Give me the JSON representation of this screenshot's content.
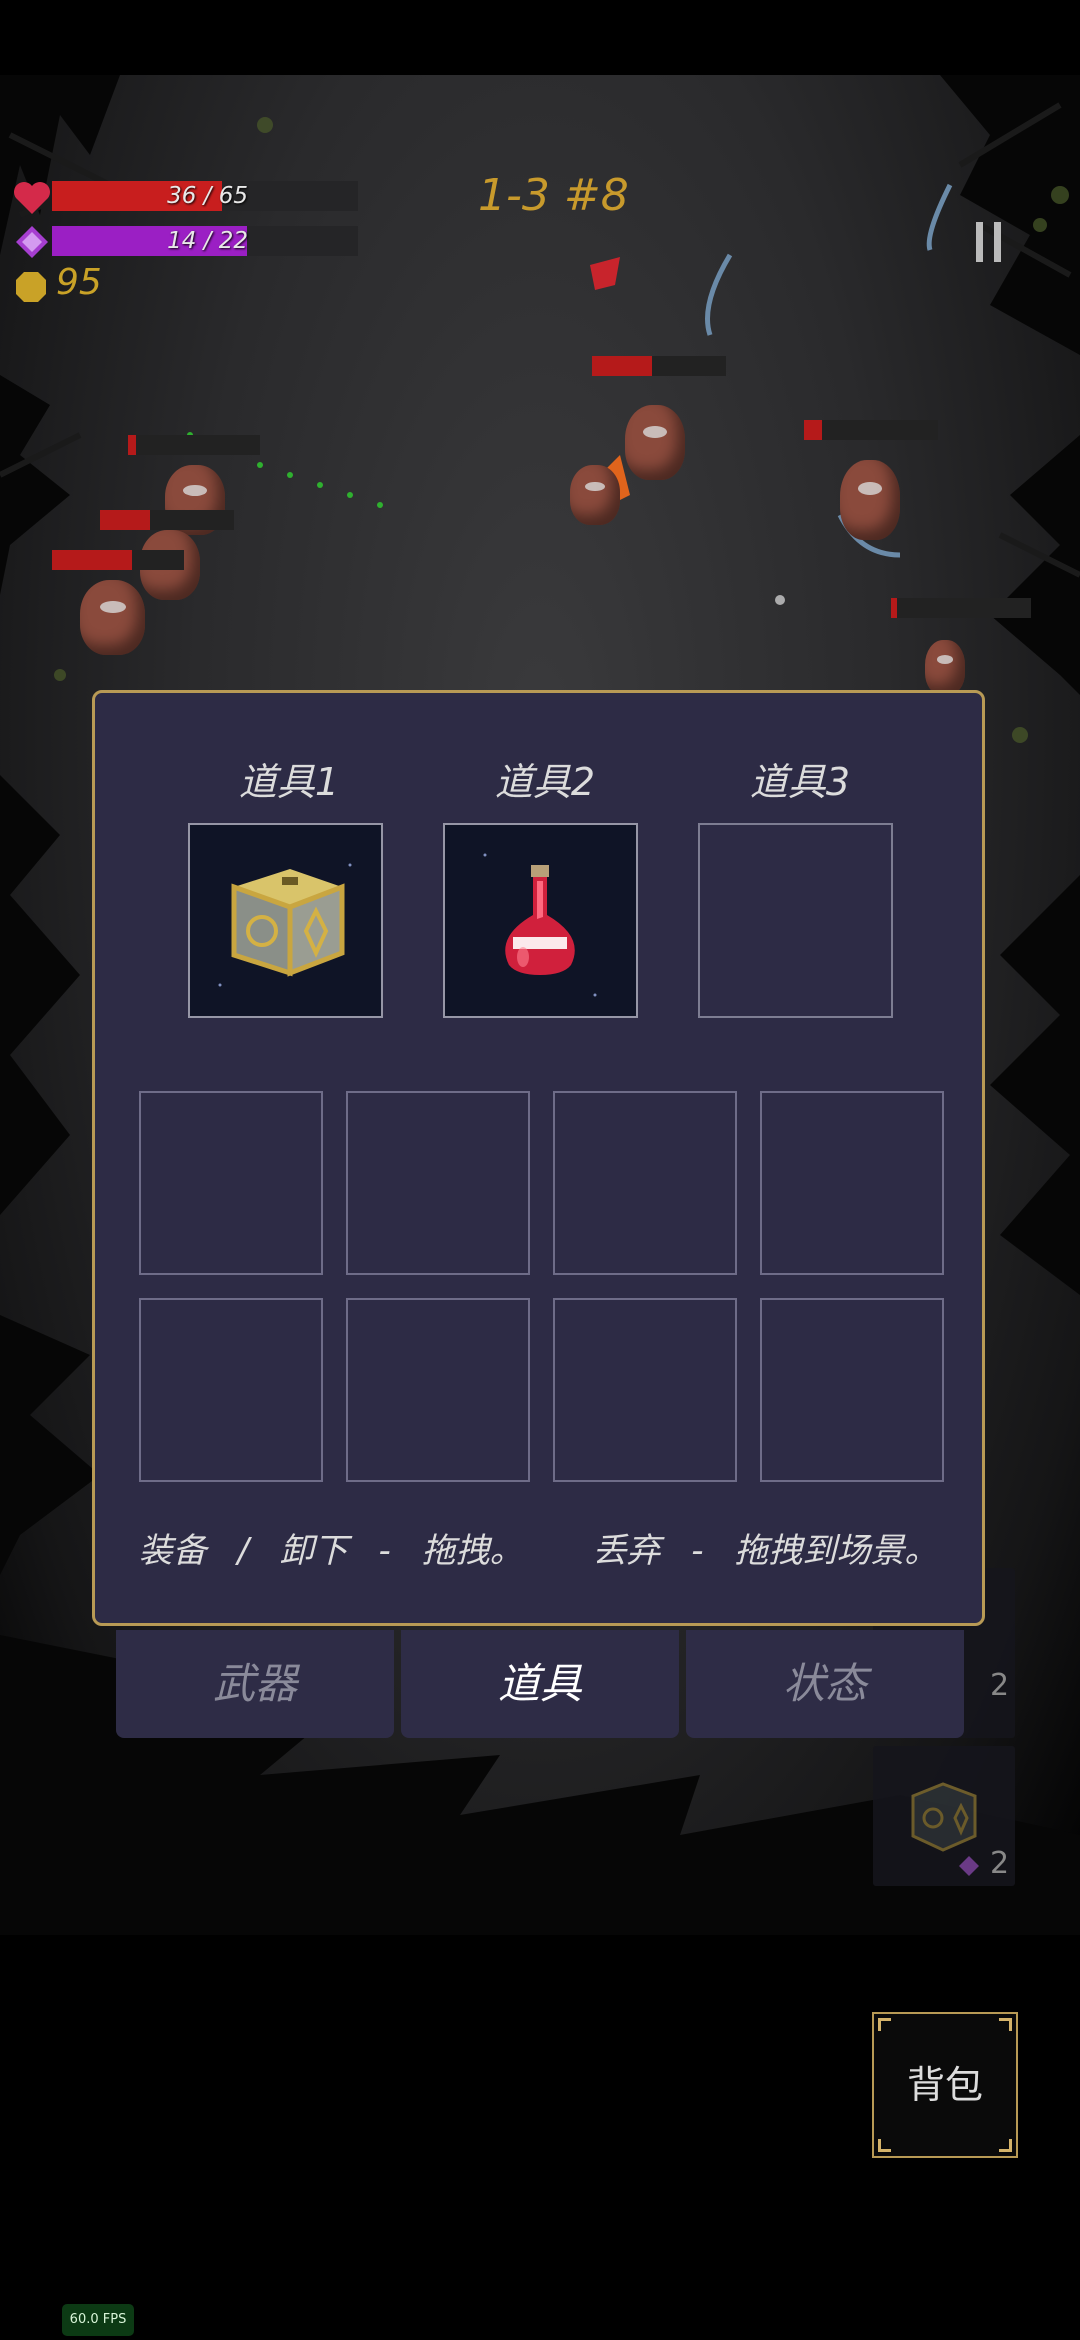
{
  "hud": {
    "hp_text": "36 / 65",
    "hp_fraction": 0.554,
    "mana_text": "14 / 22",
    "mana_fraction": 0.636,
    "gold": "95",
    "level_label": "1-3 #8",
    "colors": {
      "hp": "#c81e1e",
      "mana": "#9b1fc4",
      "gold": "#c9a227",
      "level": "#c89a2c"
    }
  },
  "icons": {
    "heart": "heart-icon",
    "mana": "mana-gem-icon",
    "gold": "gold-coin-icon",
    "pause": "pause-icon"
  },
  "inventory": {
    "slot_titles": [
      "道具1",
      "道具2",
      "道具3"
    ],
    "equipped": [
      "golden-rune-cube-icon",
      "red-potion-icon",
      ""
    ],
    "hint_equip": "装备 / 卸下 - 拖拽。",
    "hint_drop": "丢弃 - 拖拽到场景。"
  },
  "tabs": [
    {
      "label": "武器",
      "active": false
    },
    {
      "label": "道具",
      "active": true
    },
    {
      "label": "状态",
      "active": false
    }
  ],
  "quickbar": {
    "count_1": "2",
    "count_2": "2"
  },
  "bag_button": "背包",
  "fps": "60.0 FPS",
  "panel_colors": {
    "background": "#2d2b45",
    "border": "#b89a55"
  }
}
